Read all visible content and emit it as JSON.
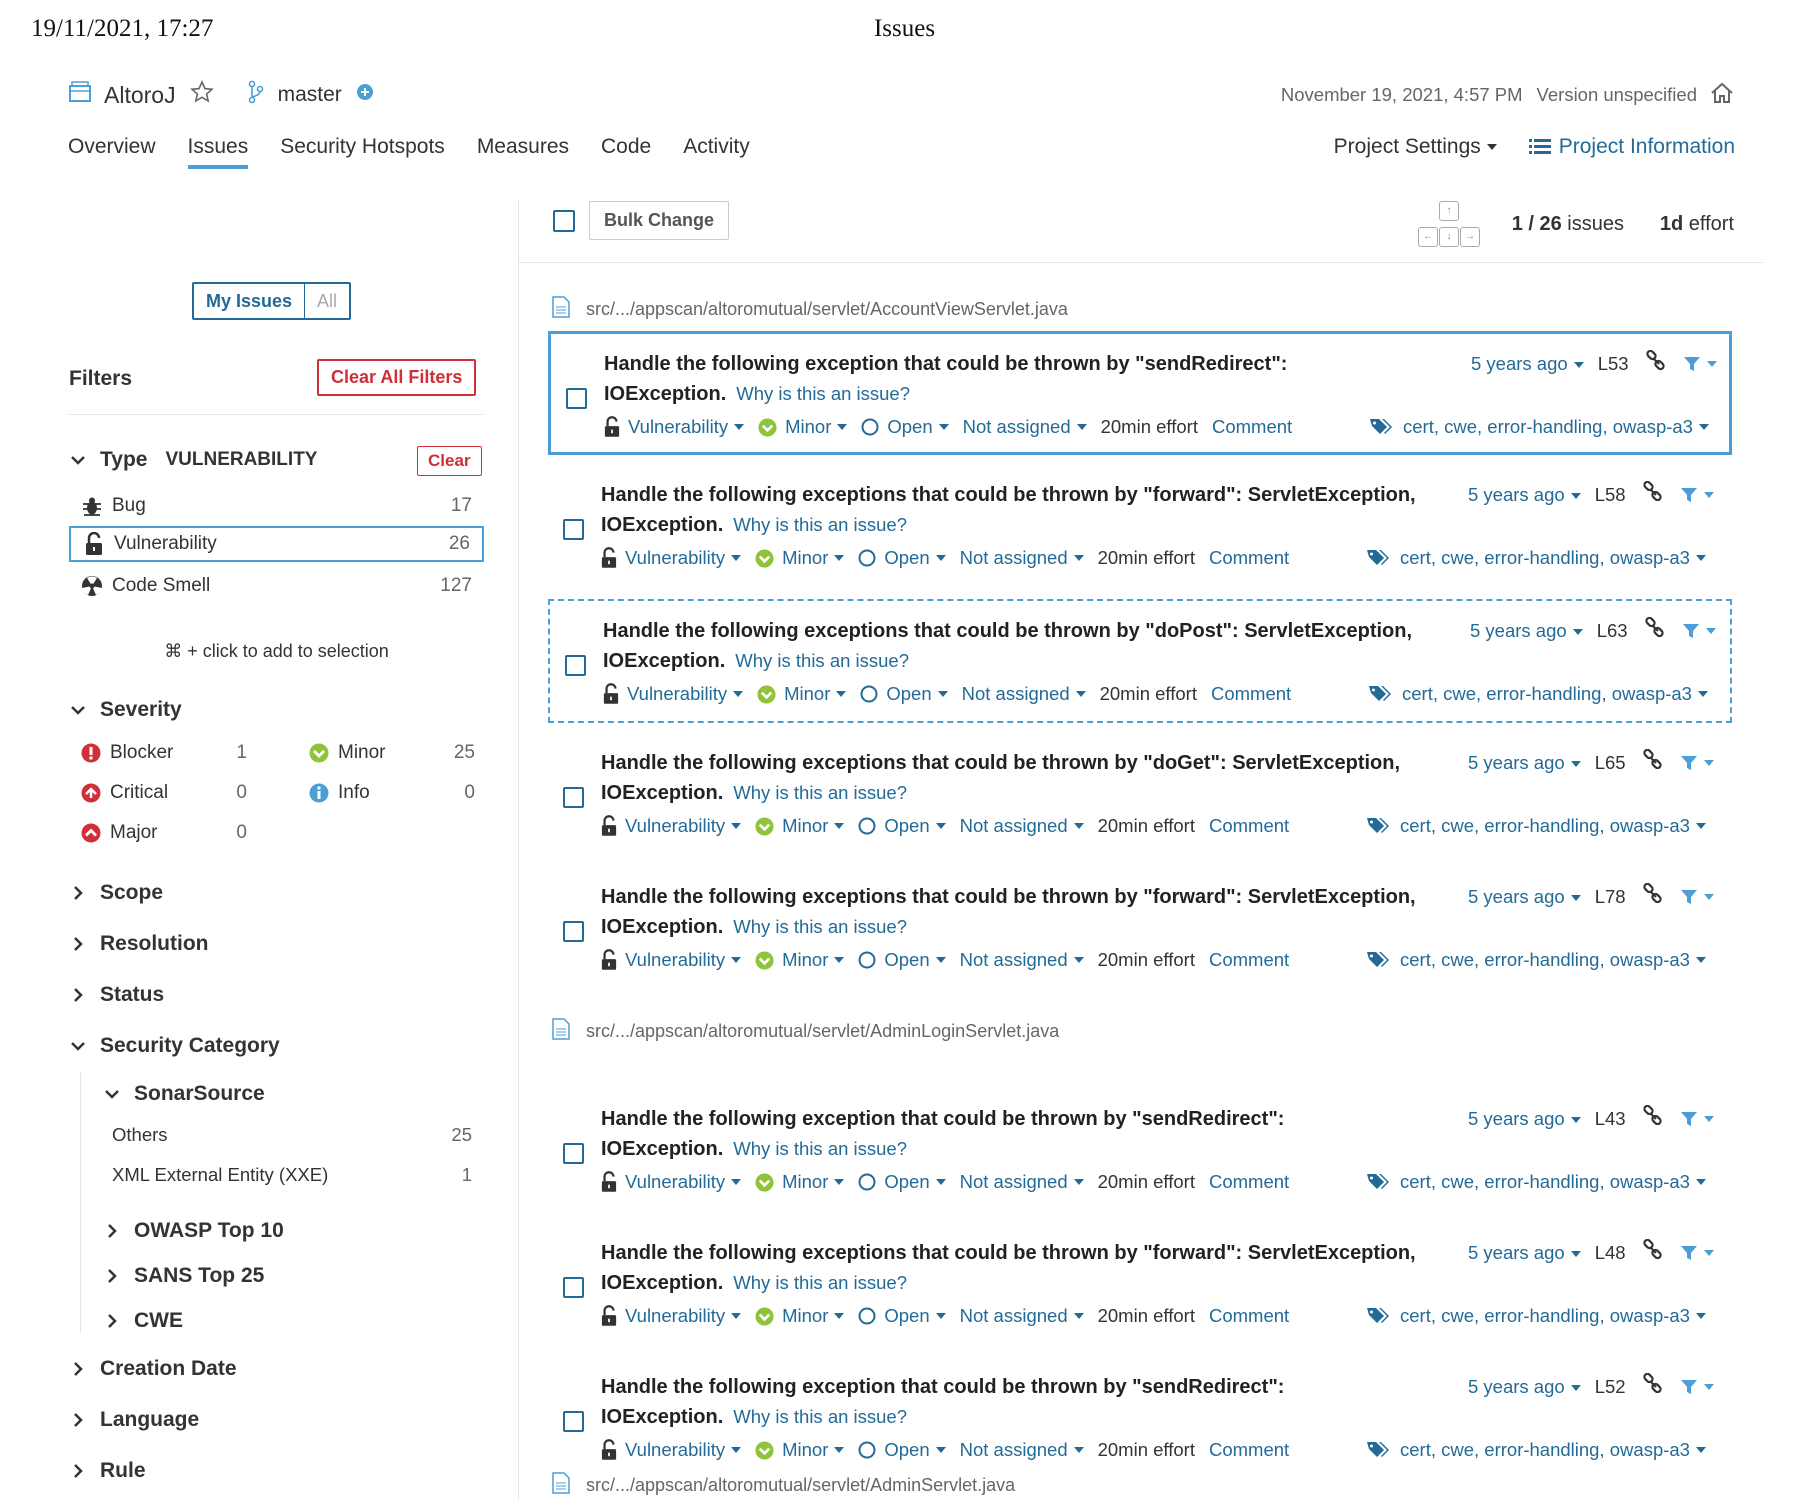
{
  "print": {
    "date": "19/11/2021, 17:27",
    "title": "Issues"
  },
  "project": {
    "name": "AltoroJ",
    "branch": "master",
    "date": "November 19, 2021, 4:57 PM",
    "version": "Version unspecified"
  },
  "nav": {
    "tabs": [
      "Overview",
      "Issues",
      "Security Hotspots",
      "Measures",
      "Code",
      "Activity"
    ],
    "settings": "Project Settings",
    "info": "Project Information"
  },
  "sidebar": {
    "my_issues": "My Issues",
    "all": "All",
    "filters_title": "Filters",
    "clear_all": "Clear All Filters",
    "type": {
      "label": "Type",
      "selected": "VULNERABILITY",
      "clear": "Clear",
      "items": [
        {
          "label": "Bug",
          "count": "17"
        },
        {
          "label": "Vulnerability",
          "count": "26"
        },
        {
          "label": "Code Smell",
          "count": "127"
        }
      ]
    },
    "hint": "⌘ + click to add to selection",
    "severity": {
      "label": "Severity",
      "items": [
        {
          "label": "Blocker",
          "count": "1"
        },
        {
          "label": "Critical",
          "count": "0"
        },
        {
          "label": "Major",
          "count": "0"
        },
        {
          "label": "Minor",
          "count": "25"
        },
        {
          "label": "Info",
          "count": "0"
        }
      ]
    },
    "facets": [
      "Scope",
      "Resolution",
      "Status"
    ],
    "security": {
      "label": "Security Category",
      "sonarsource": "SonarSource",
      "items": [
        {
          "label": "Others",
          "count": "25"
        },
        {
          "label": "XML External Entity (XXE)",
          "count": "1"
        }
      ],
      "groups": [
        "OWASP Top 10",
        "SANS Top 25",
        "CWE"
      ]
    },
    "bottom_facets": [
      "Creation Date",
      "Language",
      "Rule"
    ]
  },
  "toolbar": {
    "bulk": "Bulk Change",
    "count_current": "1 / 26",
    "count_label": "issues",
    "effort_value": "1d",
    "effort_label": "effort"
  },
  "common": {
    "why": "Why is this an issue?",
    "type": "Vulnerability",
    "severity": "Minor",
    "status": "Open",
    "assignee": "Not assigned",
    "effort": "20min effort",
    "comment": "Comment",
    "tags": "cert, cwe, error-handling, owasp-a3"
  },
  "files": [
    "src/.../appscan/altoromutual/servlet/AccountViewServlet.java",
    "src/.../appscan/altoromutual/servlet/AdminLoginServlet.java",
    "src/.../appscan/altoromutual/servlet/AdminServlet.java"
  ],
  "issues": [
    {
      "l1": "Handle the following exception that could be thrown by \"sendRedirect\":",
      "l2": "IOException.",
      "age": "5 years ago",
      "line": "L53"
    },
    {
      "l1": "Handle the following exceptions that could be thrown by \"forward\": ServletException,",
      "l2": "IOException.",
      "age": "5 years ago",
      "line": "L58"
    },
    {
      "l1": "Handle the following exceptions that could be thrown by \"doPost\": ServletException,",
      "l2": "IOException.",
      "age": "5 years ago",
      "line": "L63"
    },
    {
      "l1": "Handle the following exceptions that could be thrown by \"doGet\": ServletException,",
      "l2": "IOException.",
      "age": "5 years ago",
      "line": "L65"
    },
    {
      "l1": "Handle the following exceptions that could be thrown by \"forward\": ServletException,",
      "l2": "IOException.",
      "age": "5 years ago",
      "line": "L78"
    },
    {
      "l1": "Handle the following exception that could be thrown by \"sendRedirect\":",
      "l2": "IOException.",
      "age": "5 years ago",
      "line": "L43"
    },
    {
      "l1": "Handle the following exceptions that could be thrown by \"forward\": ServletException,",
      "l2": "IOException.",
      "age": "5 years ago",
      "line": "L48"
    },
    {
      "l1": "Handle the following exception that could be thrown by \"sendRedirect\":",
      "l2": "IOException.",
      "age": "5 years ago",
      "line": "L52"
    }
  ],
  "colors": {
    "accent": "#236a97",
    "highlight": "#4b9fd5",
    "danger": "#d02f3a",
    "minor": "#8fc43a"
  }
}
